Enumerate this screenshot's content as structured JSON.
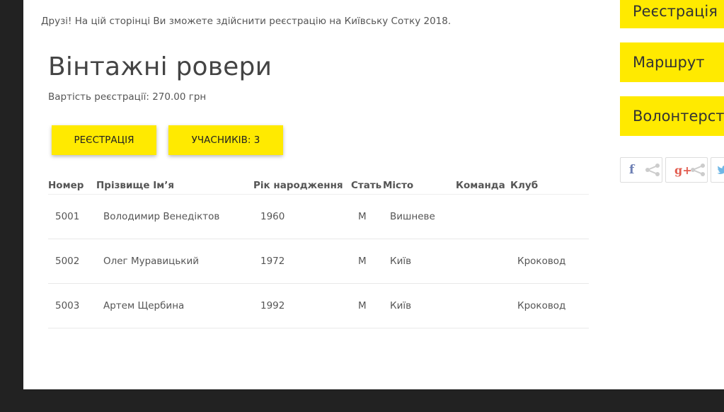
{
  "intro": "Друзі! На цій сторінці Ви зможете здійснити реєстрацію на Київську Сотку 2018.",
  "event": {
    "title": "Вінтажні ровери",
    "price_label": "Вартість реєстрації: 270.00 грн"
  },
  "buttons": {
    "register": "РЕЄСТРАЦІЯ",
    "participants": "УЧАСНИКІВ: 3"
  },
  "table": {
    "headers": {
      "number": "Номер",
      "name": "Прізвище Ім’я",
      "birth_year": "Рік народження",
      "sex": "Стать",
      "city": "Місто",
      "team": "Команда",
      "club": "Клуб"
    },
    "rows": [
      {
        "number": "5001",
        "name": "Володимир Венедіктов",
        "birth_year": "1960",
        "sex": "М",
        "city": "Вишневе",
        "team": "",
        "club": ""
      },
      {
        "number": "5002",
        "name": "Олег Муравицький",
        "birth_year": "1972",
        "sex": "М",
        "city": "Київ",
        "team": "",
        "club": "Кроковод"
      },
      {
        "number": "5003",
        "name": "Артем Щербина",
        "birth_year": "1992",
        "sex": "М",
        "city": "Київ",
        "team": "",
        "club": "Кроковод"
      }
    ]
  },
  "sidebar": {
    "items": [
      {
        "label": "Реєстрація"
      },
      {
        "label": "Маршрут"
      },
      {
        "label": "Волонтерство"
      }
    ]
  },
  "share": {
    "facebook_glyph": "f",
    "googleplus_glyph": "g+",
    "twitter_icon": "twitter-icon",
    "share_icon": "share-icon"
  },
  "colors": {
    "accent": "#ffea00",
    "page_bg": "#222222"
  }
}
